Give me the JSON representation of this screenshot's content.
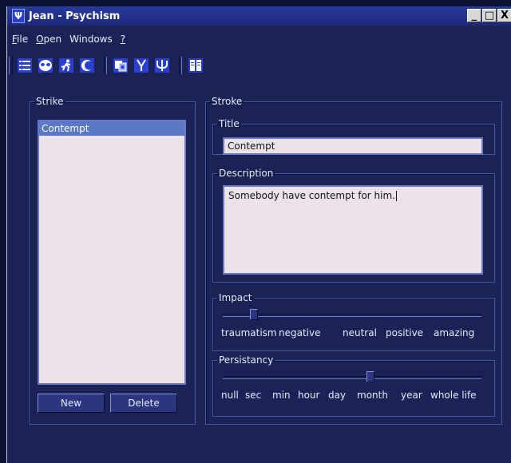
{
  "window": {
    "title": "Jean - Psychism",
    "app_icon": "Ψ",
    "min_glyph": "_",
    "max_glyph": "□",
    "close_glyph": "X"
  },
  "menu": [
    {
      "label_u": "F",
      "label_rest": "ile"
    },
    {
      "label_u": "O",
      "label_rest": "pen"
    },
    {
      "label_u": "",
      "label_rest": "Windows"
    },
    {
      "label_u": "?",
      "label_rest": ""
    }
  ],
  "toolbar_icons": [
    "list-icon",
    "mask-icon",
    "running-man-icon",
    "moon-icon",
    "dialog-icon",
    "figure-icon",
    "psi-icon",
    "book-icon"
  ],
  "strike": {
    "legend": "Strike",
    "items": [
      "Contempt"
    ],
    "selected_index": 0,
    "new_label": "New",
    "delete_label": "Delete"
  },
  "stroke": {
    "legend": "Stroke",
    "title_legend": "Title",
    "title_value": "Contempt",
    "description_legend": "Description",
    "description_value": "Somebody have contempt for him.",
    "impact_legend": "Impact",
    "impact_labels": [
      "traumatism",
      "negative",
      "neutral",
      "positive",
      "amazing"
    ],
    "impact_value": 0.12,
    "persistancy_legend": "Persistancy",
    "persistancy_labels": [
      "null",
      "sec",
      "min",
      "hour",
      "day",
      "month",
      "year",
      "whole life"
    ],
    "persistancy_value": 0.57
  },
  "colors": {
    "background": "#1b2255",
    "accent": "#5b78c4",
    "field": "#ece2ea"
  }
}
